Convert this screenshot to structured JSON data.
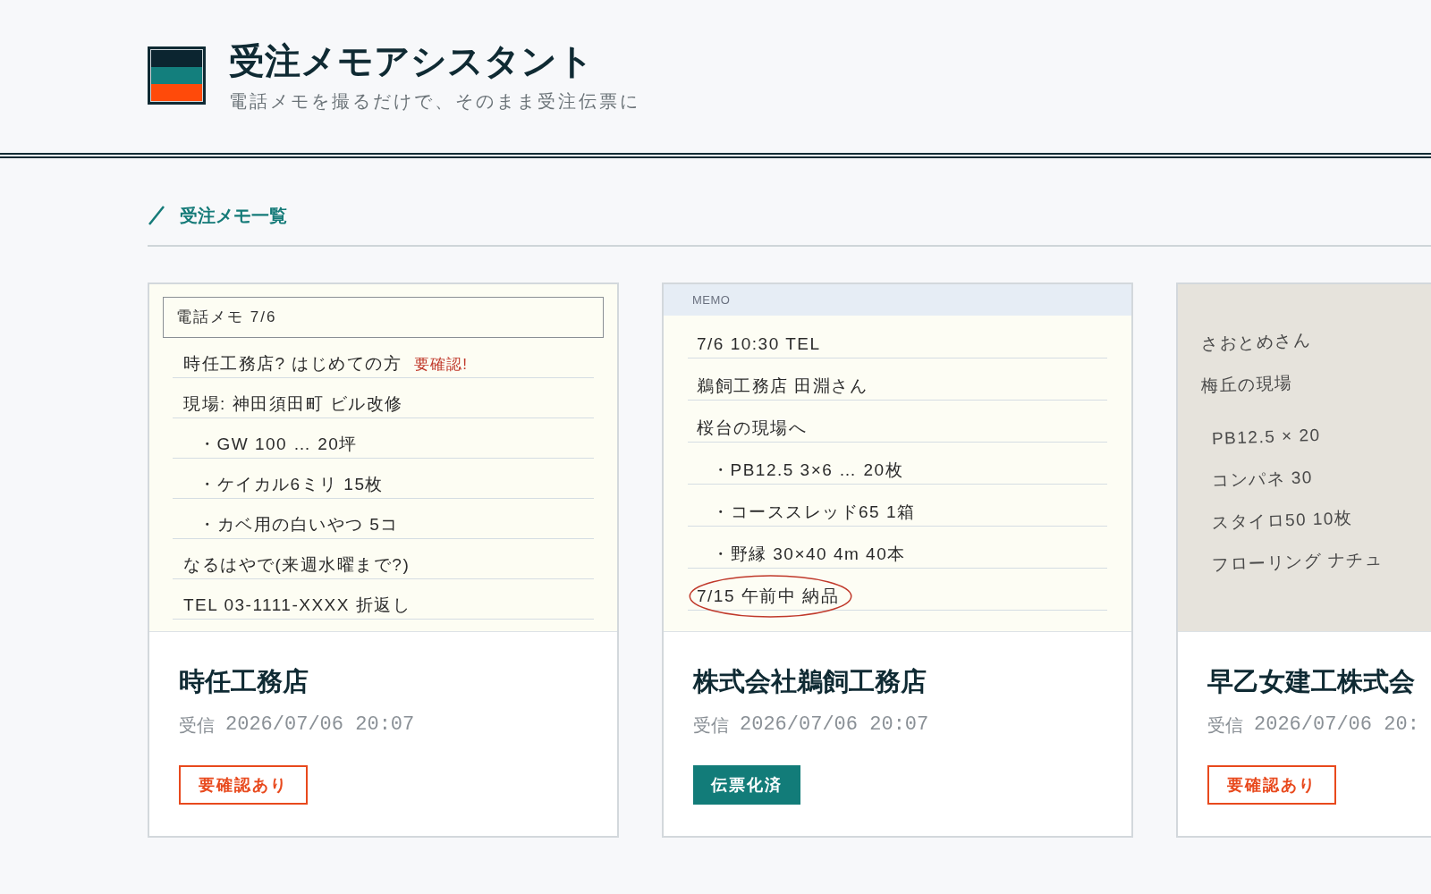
{
  "header": {
    "title": "受注メモアシスタント",
    "subtitle": "電話メモを撮るだけで、そのまま受注伝票に"
  },
  "section": {
    "title": "受注メモ一覧"
  },
  "cards": [
    {
      "memo": {
        "kind": "lined_note",
        "heading": "電話メモ 7/6",
        "lines": [
          {
            "text": "時任工務店? はじめての方",
            "note": "要確認!",
            "circled": false
          },
          {
            "text": "現場: 神田須田町 ビル改修",
            "circled": false,
            "children": [
              {
                "text": "・GW 100 … 20坪",
                "circled": false
              },
              {
                "text": "・ケイカル6ミリ 15枚",
                "circled": false
              },
              {
                "text": "・カベ用の白いやつ 5コ",
                "circled": false
              }
            ]
          },
          {
            "text": "なるはやで(来週水曜まで?)",
            "circled": false
          },
          {
            "text": "TEL 03-1111-XXXX 折返し",
            "circled": false
          }
        ]
      },
      "name": "時任工務店",
      "received_label": "受信",
      "received_at": "2026/07/06 20:07",
      "status": {
        "kind": "needs_check",
        "label": "要確認あり"
      }
    },
    {
      "memo": {
        "kind": "memo_pad",
        "heading": "MEMO",
        "lines": [
          {
            "text": "7/6 10:30 TEL",
            "circled": false
          },
          {
            "text": "鵜飼工務店 田淵さん",
            "circled": false
          },
          {
            "text": "桜台の現場へ",
            "circled": false,
            "children": [
              {
                "text": "・PB12.5 3×6 … 20枚",
                "circled": false
              },
              {
                "text": "・コーススレッド65 1箱",
                "circled": false
              },
              {
                "text": "・野縁 30×40 4m 40本",
                "circled": false
              }
            ]
          },
          {
            "text": "7/15 午前中 納品",
            "circled": true
          }
        ]
      },
      "name": "株式会社鵜飼工務店",
      "received_label": "受信",
      "received_at": "2026/07/06 20:07",
      "status": {
        "kind": "invoiced",
        "label": "伝票化済"
      }
    },
    {
      "memo": {
        "kind": "paper",
        "lines": [
          {
            "text": "さおとめさん",
            "circled": false
          },
          {
            "text": "梅丘の現場",
            "circled": false,
            "children": [
              {
                "text": "PB12.5 × 20",
                "circled": false
              },
              {
                "text": "コンパネ 30",
                "circled": false
              },
              {
                "text": "スタイロ50 10枚",
                "circled": false
              },
              {
                "text": "フローリング ナチュ",
                "circled": false
              }
            ]
          }
        ]
      },
      "name": "早乙女建工株式会",
      "received_label": "受信",
      "received_at": "2026/07/06 20:",
      "status": {
        "kind": "needs_check",
        "label": "要確認あり"
      }
    }
  ]
}
